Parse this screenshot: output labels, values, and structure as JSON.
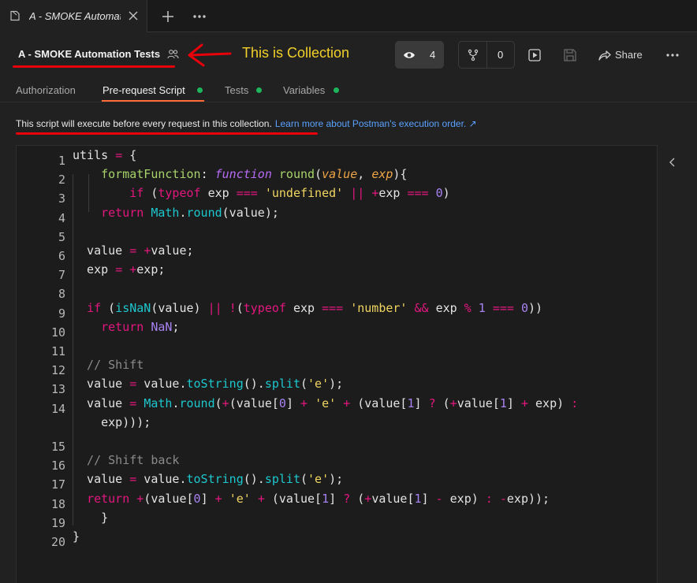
{
  "tab": {
    "title": "A - SMOKE Automation Tests"
  },
  "header": {
    "collection_name": "A - SMOKE Automation Tests",
    "annotation": "This is Collection",
    "watch_count": "4",
    "fork_count": "0",
    "share_label": "Share"
  },
  "subtabs": [
    {
      "label": "Authorization"
    },
    {
      "label": "Pre-request Script"
    },
    {
      "label": "Tests"
    },
    {
      "label": "Variables"
    }
  ],
  "info": {
    "text": "This script will execute before every request in this collection.",
    "link": "Learn more about Postman's execution order. ↗"
  },
  "code": {
    "line_numbers": [
      "1",
      "2",
      "3",
      "4",
      "5",
      "6",
      "7",
      "8",
      "9",
      "10",
      "11",
      "12",
      "13",
      "14",
      "15",
      "16",
      "17",
      "18",
      "19",
      "20"
    ],
    "lines": [
      [
        {
          "t": "utils ",
          "c": ""
        },
        {
          "t": "=",
          "c": "op"
        },
        {
          "t": " {",
          "c": ""
        }
      ],
      [
        {
          "t": "    ",
          "c": ""
        },
        {
          "t": "formatFunction",
          "c": "prop"
        },
        {
          "t": ": ",
          "c": ""
        },
        {
          "t": "function",
          "c": "ikw"
        },
        {
          "t": " ",
          "c": ""
        },
        {
          "t": "round",
          "c": "prop"
        },
        {
          "t": "(",
          "c": ""
        },
        {
          "t": "value",
          "c": "param"
        },
        {
          "t": ", ",
          "c": ""
        },
        {
          "t": "exp",
          "c": "param"
        },
        {
          "t": "){",
          "c": ""
        }
      ],
      [
        {
          "t": "        ",
          "c": ""
        },
        {
          "t": "if",
          "c": "kw"
        },
        {
          "t": " (",
          "c": ""
        },
        {
          "t": "typeof",
          "c": "kw"
        },
        {
          "t": " exp ",
          "c": ""
        },
        {
          "t": "===",
          "c": "op"
        },
        {
          "t": " ",
          "c": ""
        },
        {
          "t": "'undefined'",
          "c": "str"
        },
        {
          "t": " ",
          "c": ""
        },
        {
          "t": "||",
          "c": "op"
        },
        {
          "t": " ",
          "c": ""
        },
        {
          "t": "+",
          "c": "op"
        },
        {
          "t": "exp ",
          "c": ""
        },
        {
          "t": "===",
          "c": "op"
        },
        {
          "t": " ",
          "c": ""
        },
        {
          "t": "0",
          "c": "num"
        },
        {
          "t": ")",
          "c": ""
        }
      ],
      [
        {
          "t": "    ",
          "c": ""
        },
        {
          "t": "return",
          "c": "kw"
        },
        {
          "t": " ",
          "c": ""
        },
        {
          "t": "Math",
          "c": "fn"
        },
        {
          "t": ".",
          "c": ""
        },
        {
          "t": "round",
          "c": "fn"
        },
        {
          "t": "(value);",
          "c": ""
        }
      ],
      [],
      [
        {
          "t": "  value ",
          "c": ""
        },
        {
          "t": "=",
          "c": "op"
        },
        {
          "t": " ",
          "c": ""
        },
        {
          "t": "+",
          "c": "op"
        },
        {
          "t": "value;",
          "c": ""
        }
      ],
      [
        {
          "t": "  exp ",
          "c": ""
        },
        {
          "t": "=",
          "c": "op"
        },
        {
          "t": " ",
          "c": ""
        },
        {
          "t": "+",
          "c": "op"
        },
        {
          "t": "exp;",
          "c": ""
        }
      ],
      [],
      [
        {
          "t": "  ",
          "c": ""
        },
        {
          "t": "if",
          "c": "kw"
        },
        {
          "t": " (",
          "c": ""
        },
        {
          "t": "isNaN",
          "c": "fn"
        },
        {
          "t": "(value) ",
          "c": ""
        },
        {
          "t": "||",
          "c": "op"
        },
        {
          "t": " ",
          "c": ""
        },
        {
          "t": "!",
          "c": "op"
        },
        {
          "t": "(",
          "c": ""
        },
        {
          "t": "typeof",
          "c": "kw"
        },
        {
          "t": " exp ",
          "c": ""
        },
        {
          "t": "===",
          "c": "op"
        },
        {
          "t": " ",
          "c": ""
        },
        {
          "t": "'number'",
          "c": "str"
        },
        {
          "t": " ",
          "c": ""
        },
        {
          "t": "&&",
          "c": "op"
        },
        {
          "t": " exp ",
          "c": ""
        },
        {
          "t": "%",
          "c": "op"
        },
        {
          "t": " ",
          "c": ""
        },
        {
          "t": "1",
          "c": "num"
        },
        {
          "t": " ",
          "c": ""
        },
        {
          "t": "===",
          "c": "op"
        },
        {
          "t": " ",
          "c": ""
        },
        {
          "t": "0",
          "c": "num"
        },
        {
          "t": "))",
          "c": ""
        }
      ],
      [
        {
          "t": "    ",
          "c": ""
        },
        {
          "t": "return",
          "c": "kw"
        },
        {
          "t": " ",
          "c": ""
        },
        {
          "t": "NaN",
          "c": "num"
        },
        {
          "t": ";",
          "c": ""
        }
      ],
      [],
      [
        {
          "t": "  // Shift",
          "c": "cm"
        }
      ],
      [
        {
          "t": "  value ",
          "c": ""
        },
        {
          "t": "=",
          "c": "op"
        },
        {
          "t": " value.",
          "c": ""
        },
        {
          "t": "toString",
          "c": "fn"
        },
        {
          "t": "().",
          "c": ""
        },
        {
          "t": "split",
          "c": "fn"
        },
        {
          "t": "(",
          "c": ""
        },
        {
          "t": "'e'",
          "c": "str"
        },
        {
          "t": ");",
          "c": ""
        }
      ],
      [
        {
          "t": "  value ",
          "c": ""
        },
        {
          "t": "=",
          "c": "op"
        },
        {
          "t": " ",
          "c": ""
        },
        {
          "t": "Math",
          "c": "fn"
        },
        {
          "t": ".",
          "c": ""
        },
        {
          "t": "round",
          "c": "fn"
        },
        {
          "t": "(",
          "c": ""
        },
        {
          "t": "+",
          "c": "op"
        },
        {
          "t": "(value[",
          "c": ""
        },
        {
          "t": "0",
          "c": "num"
        },
        {
          "t": "] ",
          "c": ""
        },
        {
          "t": "+",
          "c": "op"
        },
        {
          "t": " ",
          "c": ""
        },
        {
          "t": "'e'",
          "c": "str"
        },
        {
          "t": " ",
          "c": ""
        },
        {
          "t": "+",
          "c": "op"
        },
        {
          "t": " (value[",
          "c": ""
        },
        {
          "t": "1",
          "c": "num"
        },
        {
          "t": "] ",
          "c": ""
        },
        {
          "t": "?",
          "c": "op"
        },
        {
          "t": " (",
          "c": ""
        },
        {
          "t": "+",
          "c": "op"
        },
        {
          "t": "value[",
          "c": ""
        },
        {
          "t": "1",
          "c": "num"
        },
        {
          "t": "] ",
          "c": ""
        },
        {
          "t": "+",
          "c": "op"
        },
        {
          "t": " exp) ",
          "c": ""
        },
        {
          "t": ":",
          "c": "op"
        }
      ],
      [
        {
          "t": "    exp)));",
          "c": ""
        }
      ],
      [
        {
          "t": "  // Shift back",
          "c": "cm"
        }
      ],
      [
        {
          "t": "  value ",
          "c": ""
        },
        {
          "t": "=",
          "c": "op"
        },
        {
          "t": " value.",
          "c": ""
        },
        {
          "t": "toString",
          "c": "fn"
        },
        {
          "t": "().",
          "c": ""
        },
        {
          "t": "split",
          "c": "fn"
        },
        {
          "t": "(",
          "c": ""
        },
        {
          "t": "'e'",
          "c": "str"
        },
        {
          "t": ");",
          "c": ""
        }
      ],
      [
        {
          "t": "  ",
          "c": ""
        },
        {
          "t": "return",
          "c": "kw"
        },
        {
          "t": " ",
          "c": ""
        },
        {
          "t": "+",
          "c": "op"
        },
        {
          "t": "(value[",
          "c": ""
        },
        {
          "t": "0",
          "c": "num"
        },
        {
          "t": "] ",
          "c": ""
        },
        {
          "t": "+",
          "c": "op"
        },
        {
          "t": " ",
          "c": ""
        },
        {
          "t": "'e'",
          "c": "str"
        },
        {
          "t": " ",
          "c": ""
        },
        {
          "t": "+",
          "c": "op"
        },
        {
          "t": " (value[",
          "c": ""
        },
        {
          "t": "1",
          "c": "num"
        },
        {
          "t": "] ",
          "c": ""
        },
        {
          "t": "?",
          "c": "op"
        },
        {
          "t": " (",
          "c": ""
        },
        {
          "t": "+",
          "c": "op"
        },
        {
          "t": "value[",
          "c": ""
        },
        {
          "t": "1",
          "c": "num"
        },
        {
          "t": "] ",
          "c": ""
        },
        {
          "t": "-",
          "c": "op"
        },
        {
          "t": " exp) ",
          "c": ""
        },
        {
          "t": ":",
          "c": "op"
        },
        {
          "t": " ",
          "c": ""
        },
        {
          "t": "-",
          "c": "op"
        },
        {
          "t": "exp));",
          "c": ""
        }
      ],
      [
        {
          "t": "    }",
          "c": ""
        }
      ],
      [
        {
          "t": "}",
          "c": ""
        }
      ]
    ]
  },
  "colors": {
    "accent": "#ff6c37",
    "annotation_red": "#e8000b",
    "annotation_text": "#f2d02a",
    "status_green": "#1fb55a",
    "link": "#5aa2ff"
  },
  "icons": [
    "collection-file-icon",
    "close-icon",
    "plus-icon",
    "more-horizontal-icon",
    "people-icon",
    "eye-icon",
    "fork-icon",
    "run-icon",
    "save-icon",
    "share-icon",
    "chevron-left-icon"
  ]
}
